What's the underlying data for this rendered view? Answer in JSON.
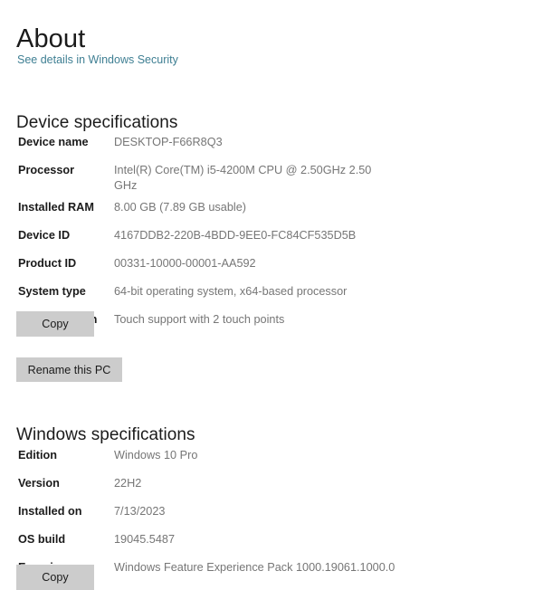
{
  "page": {
    "title": "About",
    "security_link": "See details in Windows Security"
  },
  "device_specifications": {
    "heading": "Device specifications",
    "rows": [
      {
        "label": "Device name",
        "value": "DESKTOP-F66R8Q3"
      },
      {
        "label": "Processor",
        "value": "Intel(R) Core(TM) i5-4200M CPU @ 2.50GHz   2.50 GHz"
      },
      {
        "label": "Installed RAM",
        "value": "8.00 GB (7.89 GB usable)"
      },
      {
        "label": "Device ID",
        "value": "4167DDB2-220B-4BDD-9EE0-FC84CF535D5B"
      },
      {
        "label": "Product ID",
        "value": "00331-10000-00001-AA592"
      },
      {
        "label": "System type",
        "value": "64-bit operating system, x64-based processor"
      },
      {
        "label": "Pen and touch",
        "value": "Touch support with 2 touch points"
      }
    ],
    "copy_label": "Copy",
    "rename_label": "Rename this PC"
  },
  "windows_specifications": {
    "heading": "Windows specifications",
    "rows": [
      {
        "label": "Edition",
        "value": "Windows 10 Pro"
      },
      {
        "label": "Version",
        "value": "22H2"
      },
      {
        "label": "Installed on",
        "value": "7/13/2023"
      },
      {
        "label": "OS build",
        "value": "19045.5487"
      },
      {
        "label": "Experience",
        "value": "Windows Feature Experience Pack 1000.19061.1000.0"
      }
    ],
    "copy_label": "Copy"
  },
  "colors": {
    "link": "#3f7f93",
    "label_text": "#1b1b1b",
    "value_text": "#767676",
    "button_face": "#cccccc",
    "background": "#ffffff"
  }
}
